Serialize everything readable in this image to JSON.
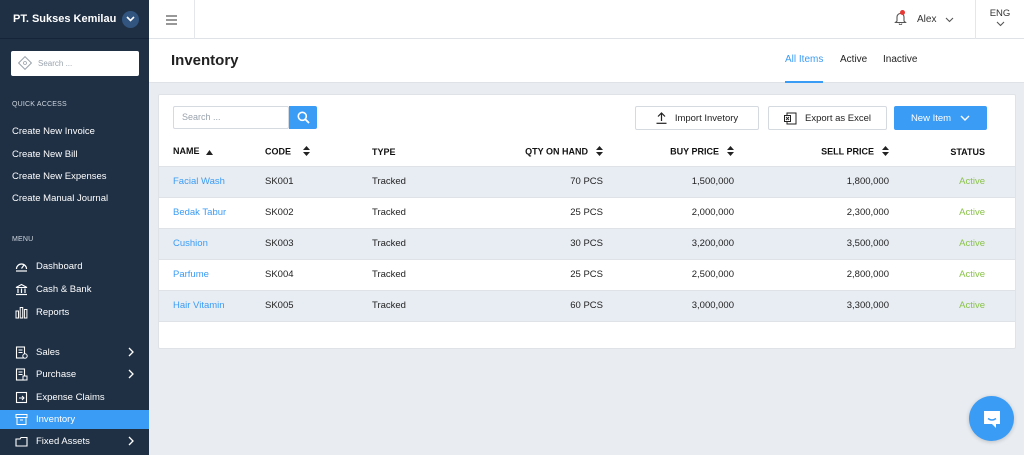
{
  "company": {
    "name": "PT. Sukses Kemilau"
  },
  "sidebar": {
    "search_placeholder": "Search ...",
    "quick_access_title": "QUICK ACCESS",
    "quick_links": [
      "Create New Invoice",
      "Create New Bill",
      "Create New Expenses",
      "Create Manual Journal"
    ],
    "menu_title": "MENU",
    "menu": [
      {
        "label": "Dashboard",
        "icon": "dashboard-icon"
      },
      {
        "label": "Cash & Bank",
        "icon": "bank-icon"
      },
      {
        "label": "Reports",
        "icon": "reports-icon"
      },
      {
        "label": "Sales",
        "icon": "sales-icon",
        "expandable": true
      },
      {
        "label": "Purchase",
        "icon": "purchase-icon",
        "expandable": true
      },
      {
        "label": "Expense Claims",
        "icon": "expense-claims-icon"
      },
      {
        "label": "Inventory",
        "icon": "inventory-icon",
        "active": true
      },
      {
        "label": "Fixed Assets",
        "icon": "fixed-assets-icon",
        "expandable": true
      }
    ]
  },
  "topbar": {
    "user_name": "Alex",
    "language": "ENG"
  },
  "page": {
    "title": "Inventory",
    "tabs": [
      "All Items",
      "Active",
      "Inactive"
    ],
    "active_tab": "All Items"
  },
  "toolbar": {
    "search_placeholder": "Search ...",
    "import_label": "Import Invetory",
    "export_label": "Export as Excel",
    "new_label": "New Item"
  },
  "table": {
    "headers": [
      "NAME",
      "CODE",
      "TYPE",
      "QTY ON HAND",
      "BUY PRICE",
      "SELL PRICE",
      "STATUS"
    ],
    "rows": [
      [
        "Facial Wash",
        "SK001",
        "Tracked",
        "70 PCS",
        "1,500,000",
        "1,800,000",
        "Active"
      ],
      [
        "Bedak Tabur",
        "SK002",
        "Tracked",
        "25 PCS",
        "2,000,000",
        "2,300,000",
        "Active"
      ],
      [
        "Cushion",
        "SK003",
        "Tracked",
        "30 PCS",
        "3,200,000",
        "3,500,000",
        "Active"
      ],
      [
        "Parfume",
        "SK004",
        "Tracked",
        "25 PCS",
        "2,500,000",
        "2,800,000",
        "Active"
      ],
      [
        "Hair Vitamin",
        "SK005",
        "Tracked",
        "60 PCS",
        "3,000,000",
        "3,300,000",
        "Active"
      ]
    ]
  },
  "colors": {
    "sidebar": "#1f3045",
    "accent": "#3b9cf5",
    "active_status": "#8bc34a"
  }
}
